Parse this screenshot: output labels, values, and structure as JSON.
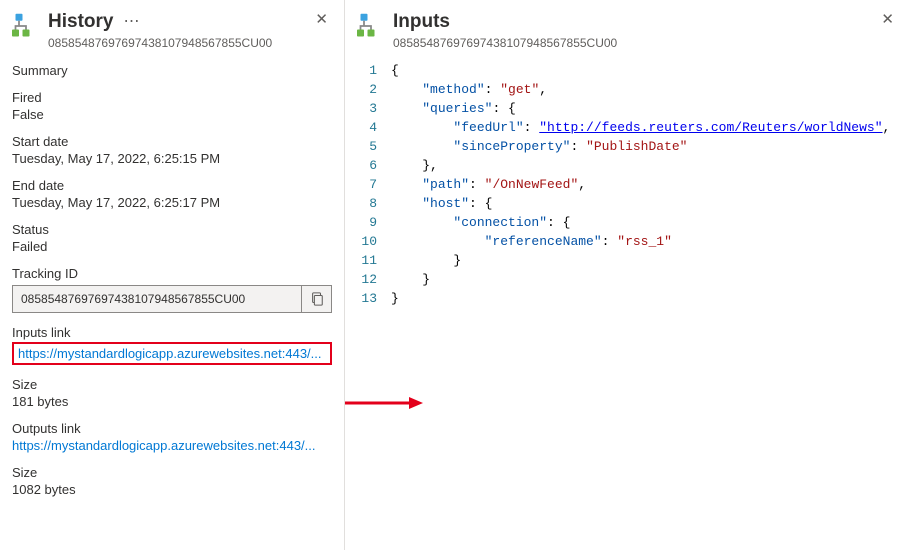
{
  "history": {
    "title": "History",
    "subtitle": "08585487697697438107948567855CU00",
    "summary_label": "Summary",
    "fired_label": "Fired",
    "fired_value": "False",
    "start_label": "Start date",
    "start_value": "Tuesday, May 17, 2022, 6:25:15 PM",
    "end_label": "End date",
    "end_value": "Tuesday, May 17, 2022, 6:25:17 PM",
    "status_label": "Status",
    "status_value": "Failed",
    "tracking_label": "Tracking ID",
    "tracking_value": "08585487697697438107948567855CU00",
    "inputs_link_label": "Inputs link",
    "inputs_link_value": "https://mystandardlogicapp.azurewebsites.net:443/...",
    "inputs_size_label": "Size",
    "inputs_size_value": "181 bytes",
    "outputs_link_label": "Outputs link",
    "outputs_link_value": "https://mystandardlogicapp.azurewebsites.net:443/...",
    "outputs_size_label": "Size",
    "outputs_size_value": "1082 bytes"
  },
  "inputs": {
    "title": "Inputs",
    "subtitle": "08585487697697438107948567855CU00",
    "json": {
      "method": "get",
      "queries": {
        "feedUrl": "http://feeds.reuters.com/Reuters/worldNews",
        "sinceProperty": "PublishDate"
      },
      "path": "/OnNewFeed",
      "host": {
        "connection": {
          "referenceName": "rss_1"
        }
      }
    }
  },
  "colors": {
    "highlight": "#e3001b",
    "link": "#0078d4"
  }
}
